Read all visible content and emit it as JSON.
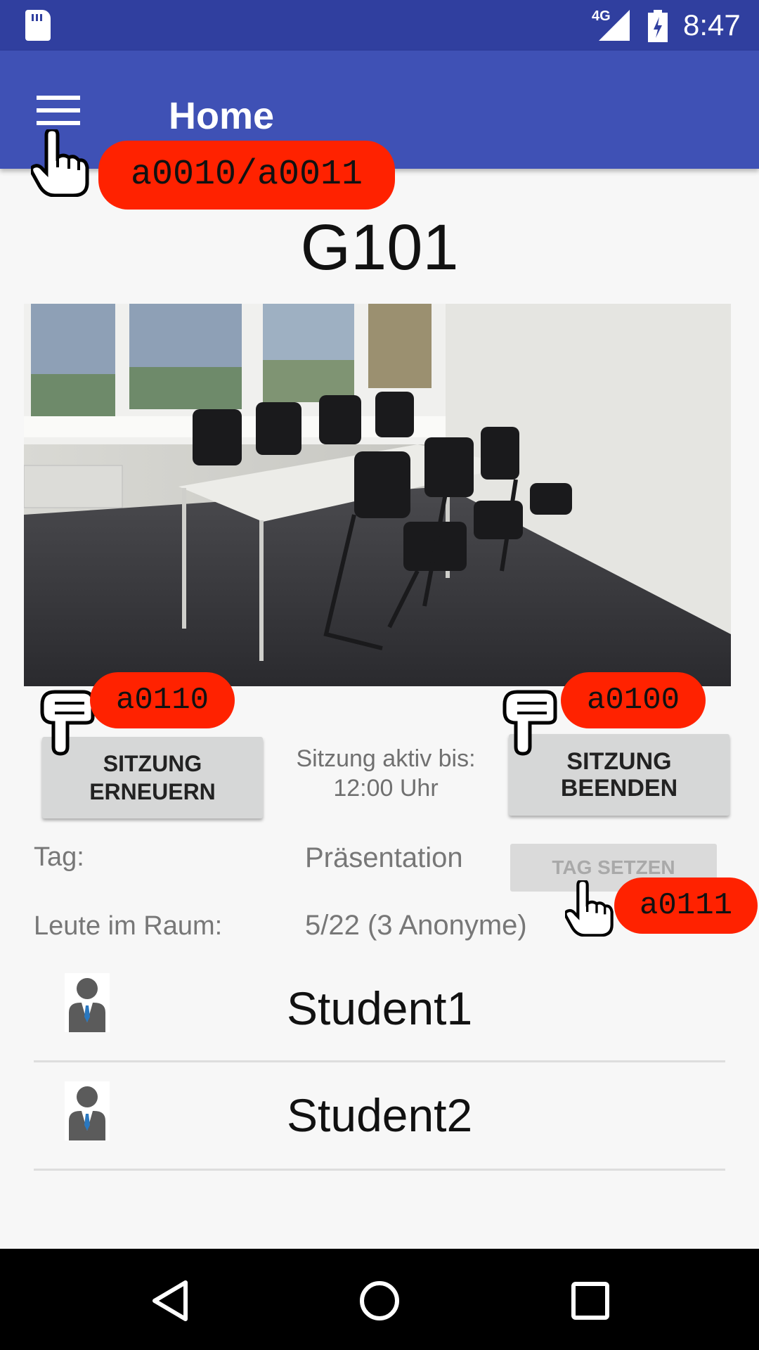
{
  "status_bar": {
    "network": "4G",
    "time": "8:47"
  },
  "app_bar": {
    "title": "Home"
  },
  "room": {
    "name": "G101"
  },
  "session": {
    "renew_button": "SITZUNG ERNEUERN",
    "end_button": "SITZUNG BEENDEN",
    "status_line1": "Sitzung aktiv bis:",
    "status_line2": "12:00 Uhr"
  },
  "info": {
    "tag_label": "Tag:",
    "tag_value": "Präsentation",
    "set_tag_button": "TAG SETZEN",
    "people_label": "Leute im Raum:",
    "people_value": "5/22 (3 Anonyme)"
  },
  "students": [
    {
      "name": "Student1"
    },
    {
      "name": "Student2"
    }
  ],
  "annotations": {
    "menu": "a0010/a0011",
    "renew": "a0110",
    "end": "a0100",
    "tag": "a0111"
  }
}
